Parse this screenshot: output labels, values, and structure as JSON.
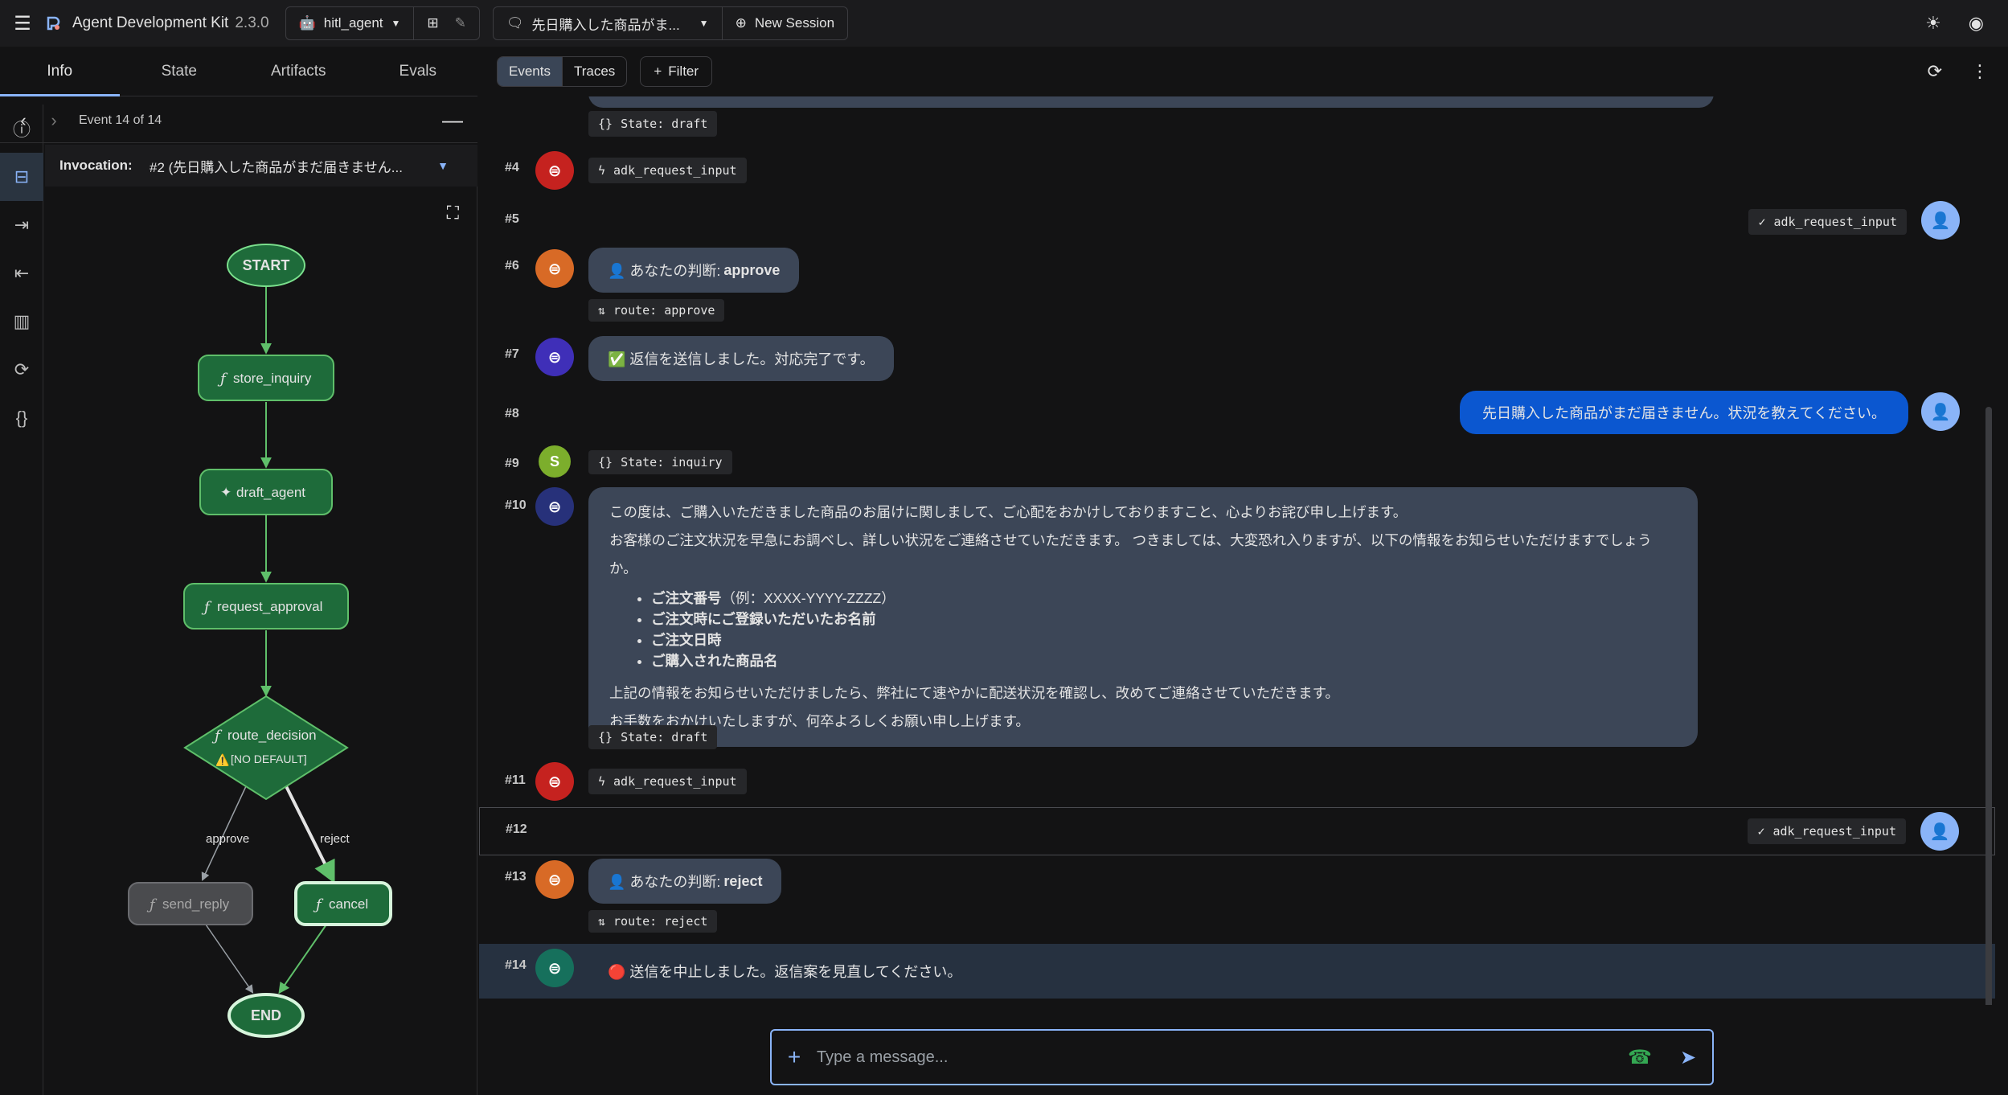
{
  "app": {
    "title": "Agent Development Kit",
    "version": "2.3.0",
    "agent": "hitl_agent",
    "session_title": "先日購入した商品がま...",
    "new_session": "New Session"
  },
  "left_tabs": [
    "Info",
    "State",
    "Artifacts",
    "Evals"
  ],
  "event_nav": {
    "label": "Event 14 of 14"
  },
  "invocation": {
    "label": "Invocation:",
    "value": "#2 (先日購入した商品がまだ届きません..."
  },
  "graph": {
    "start": "START",
    "end": "END",
    "store_inquiry": "store_inquiry",
    "draft_agent": "draft_agent",
    "request_approval": "request_approval",
    "route_decision": "route_decision",
    "no_default": "[NO DEFAULT]",
    "send_reply": "send_reply",
    "cancel": "cancel",
    "edge_approve": "approve",
    "edge_reject": "reject",
    "func_symbol": "ƒ",
    "agent_symbol": "✦",
    "warn_symbol": "⚠️"
  },
  "main_tabs": {
    "events": "Events",
    "traces": "Traces",
    "filter": "Filter"
  },
  "events": {
    "e3_state": "State: draft",
    "e4_idx": "#4",
    "e4_chip": "adk_request_input",
    "e5_idx": "#5",
    "e5_chip": "adk_request_input",
    "e6_idx": "#6",
    "e6_prefix": "👤 あなたの判断: ",
    "e6_value": "approve",
    "e6_route": "route: approve",
    "e7_idx": "#7",
    "e7_text": "✅ 返信を送信しました。対応完了です。",
    "e8_idx": "#8",
    "e8_text": "先日購入した商品がまだ届きません。状況を教えてください。",
    "e9_idx": "#9",
    "e9_avatar": "S",
    "e9_state": "State: inquiry",
    "e10_idx": "#10",
    "e10_p1": "この度は、ご購入いただきました商品のお届けに関しまして、ご心配をおかけしておりますこと、心よりお詫び申し上げます。",
    "e10_p2": "お客様のご注文状況を早急にお調べし、詳しい状況をご連絡させていただきます。 つきましては、大変恐れ入りますが、以下の情報をお知らせいただけますでしょうか。",
    "e10_b1": "ご注文番号",
    "e10_b1_extra": "（例：XXXX-YYYY-ZZZZ）",
    "e10_b2": "ご注文時にご登録いただいたお名前",
    "e10_b3": "ご注文日時",
    "e10_b4": "ご購入された商品名",
    "e10_p3": "上記の情報をお知らせいただけましたら、弊社にて速やかに配送状況を確認し、改めてご連絡させていただきます。",
    "e10_p4": "お手数をおかけいたしますが、何卒よろしくお願い申し上げます。",
    "e10_state": "State: draft",
    "e11_idx": "#11",
    "e11_chip": "adk_request_input",
    "e12_idx": "#12",
    "e12_chip": "adk_request_input",
    "e13_idx": "#13",
    "e13_prefix": "👤 あなたの判断: ",
    "e13_value": "reject",
    "e13_route": "route: reject",
    "e14_idx": "#14",
    "e14_text": "🔴 送信を中止しました。返信案を見直してください。"
  },
  "composer": {
    "placeholder": "Type a message..."
  }
}
